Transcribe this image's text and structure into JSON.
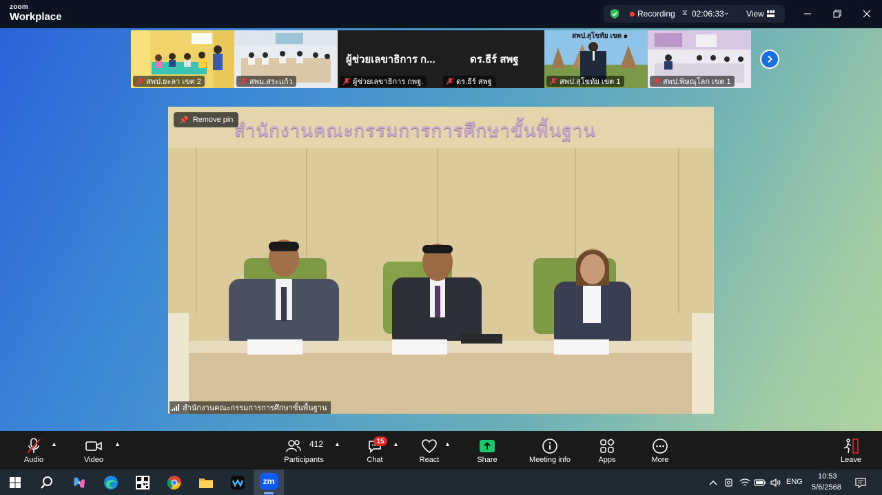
{
  "app": {
    "brand_small": "zoom",
    "brand_big": "Workplace"
  },
  "header": {
    "recording_label": "Recording",
    "timer": "02:06:33",
    "view_label": "View"
  },
  "thumbnails": [
    {
      "name": "สพป.ยะลา เขต 2"
    },
    {
      "name": "สพม.สระแก้ว"
    },
    {
      "name": "ผู้ช่วยเลขาธิการ กพฐ.",
      "display_name": "ผู้ช่วยเลขาธิการ ก..."
    },
    {
      "name": "ดร.ธีร์ สพฐ",
      "display_name": "ดร.ธีร์ สพฐ"
    },
    {
      "name": "สพป.สุโขทัย เขต 1",
      "banner": "สพป.สุโขทัย เขต ๑"
    },
    {
      "name": "สพป.พิษณุโลก เขต 1"
    }
  ],
  "main_video": {
    "remove_pin_label": "Remove pin",
    "participant_name": "สำนักงานคณะกรรมการการศึกษาขั้นพื้นฐาน",
    "banner_text": "สำนักงานคณะกรรมการการศึกษาขั้นพื้นฐาน"
  },
  "toolbar": {
    "audio": "Audio",
    "video": "Video",
    "participants": "Participants",
    "participants_count": "412",
    "chat": "Chat",
    "chat_badge": "15",
    "react": "React",
    "share": "Share",
    "meeting_info": "Meeting info",
    "apps": "Apps",
    "more": "More",
    "leave": "Leave"
  },
  "taskbar": {
    "language": "ENG",
    "time": "10:53",
    "date": "5/6/2568",
    "active_app": "zm"
  },
  "colors": {
    "share_green": "#1ec76a",
    "chat_badge_red": "#e02828",
    "next_blue": "#1a6fe0",
    "leave_red": "#e0282e"
  }
}
